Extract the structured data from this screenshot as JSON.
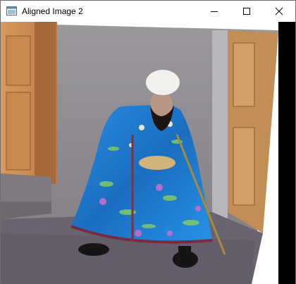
{
  "window": {
    "title": "Aligned Image 2",
    "icon": "app-window-icon"
  },
  "controls": {
    "minimize_icon": "minimize-icon",
    "maximize_icon": "maximize-icon",
    "close_icon": "close-icon"
  },
  "image": {
    "description_icon": "photo-image",
    "colors": {
      "robe_blue": "#1f7fd0",
      "wall_gray": "#8f8f95",
      "door_wood": "#c78a52",
      "floor": "#6c6670"
    }
  }
}
